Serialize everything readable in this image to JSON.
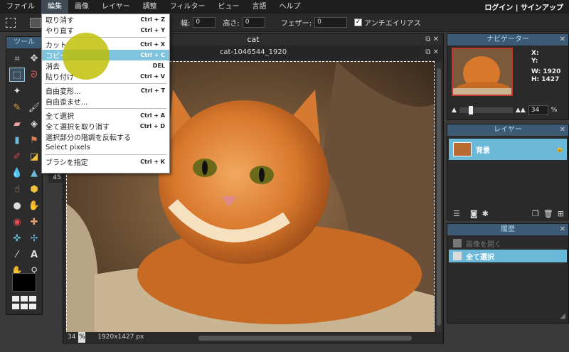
{
  "menubar": {
    "items": [
      "ファイル",
      "編集",
      "画像",
      "レイヤー",
      "調整",
      "フィルター",
      "ビュー",
      "言語",
      "ヘルプ"
    ],
    "active_index": 1,
    "login": "ログイン | サインアップ"
  },
  "optbar": {
    "width_label": "幅:",
    "width_value": "0",
    "height_label": "高さ:",
    "height_value": "0",
    "feather_label": "フェザー:",
    "feather_value": "0",
    "antialias_label": "アンチエイリアス",
    "antialias_checked": true
  },
  "tools": {
    "header": "ツール"
  },
  "document": {
    "title": "cat",
    "subtitle": "cat-1046544_1920",
    "zoom": "34",
    "zoom_unit": "%",
    "size": "1920x1427 px",
    "left_zoom": "45"
  },
  "edit_menu": {
    "items": [
      {
        "label": "取り消す",
        "key": "Ctrl + Z"
      },
      {
        "label": "やり直す",
        "key": "Ctrl + Y"
      },
      {
        "sep": true
      },
      {
        "label": "カット",
        "key": "Ctrl + X"
      },
      {
        "label": "コピー",
        "key": "Ctrl + C",
        "highlight": true
      },
      {
        "label": "消去",
        "key": "DEL"
      },
      {
        "label": "貼り付け",
        "key": "Ctrl + V"
      },
      {
        "sep": true
      },
      {
        "label": "自由変形...",
        "key": "Ctrl + T"
      },
      {
        "label": "自由歪ませ...",
        "key": ""
      },
      {
        "sep": true
      },
      {
        "label": "全て選択",
        "key": "Ctrl + A"
      },
      {
        "label": "全て選択を取り消す",
        "key": "Ctrl + D"
      },
      {
        "label": "選択部分の階調を反転する",
        "key": ""
      },
      {
        "label": "Select pixels",
        "key": ""
      },
      {
        "sep": true
      },
      {
        "label": "ブラシを指定",
        "key": "Ctrl + K"
      }
    ]
  },
  "navigator": {
    "header": "ナビゲーター",
    "x_label": "X:",
    "y_label": "Y:",
    "w_label": "W:",
    "w_value": "1920",
    "h_label": "H:",
    "h_value": "1427",
    "zoom": "34",
    "zoom_unit": "%"
  },
  "layers": {
    "header": "レイヤー",
    "items": [
      {
        "name": "背景"
      }
    ]
  },
  "history": {
    "header": "履歴",
    "items": [
      {
        "label": "画像を開く",
        "state": "dim"
      },
      {
        "label": "全て選択",
        "state": "selected"
      }
    ]
  },
  "colors": {
    "accent": "#6ab9d8",
    "panel_header": "#3d5a74",
    "cursor": "#bebe00"
  }
}
